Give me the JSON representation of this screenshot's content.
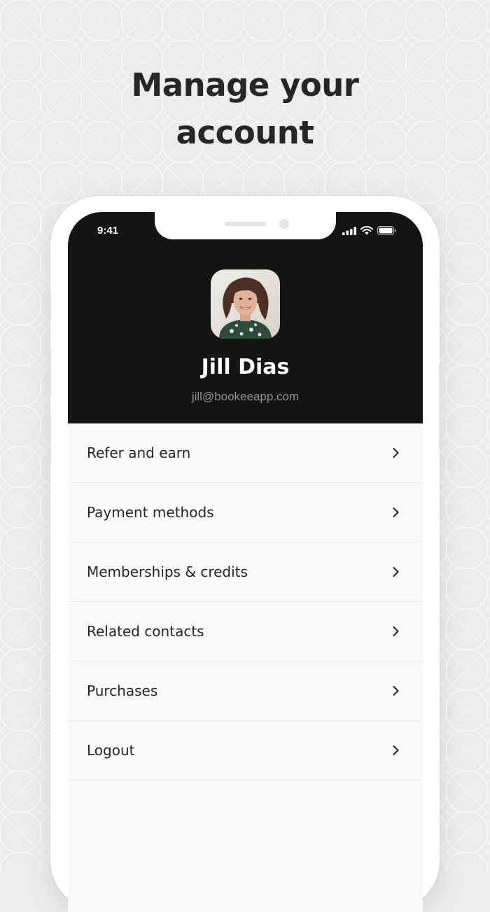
{
  "promo": {
    "headline_line1": "Manage your",
    "headline_line2": "account"
  },
  "status_bar": {
    "time": "9:41",
    "icons": [
      "cellular-signal-icon",
      "wifi-icon",
      "battery-icon"
    ]
  },
  "profile": {
    "name": "Jill Dias",
    "email": "jill@bookeeapp.com"
  },
  "menu": {
    "items": [
      {
        "label": "Refer and earn"
      },
      {
        "label": "Payment methods"
      },
      {
        "label": "Memberships & credits"
      },
      {
        "label": "Related contacts"
      },
      {
        "label": "Purchases"
      },
      {
        "label": "Logout"
      }
    ]
  },
  "colors": {
    "background": "#ececec",
    "header": "#141414",
    "list_background": "#f9f9f9",
    "text": "#262626",
    "email_text": "#8e8e8e"
  }
}
